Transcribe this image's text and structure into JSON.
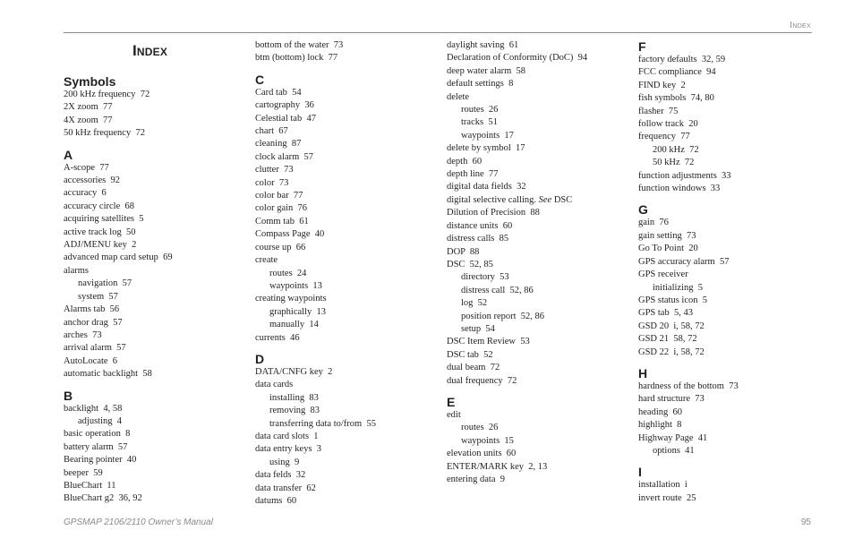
{
  "header": {
    "running_head": "Index",
    "title": "Index"
  },
  "footer": {
    "manual": "GPSMAP 2106/2110 Owner’s Manual",
    "page_number": "95"
  },
  "columns": [
    {
      "sections": [
        {
          "heading": "Symbols",
          "entries": [
            {
              "text": "200 kHz frequency  72",
              "sub": false
            },
            {
              "text": "2X zoom  77",
              "sub": false
            },
            {
              "text": "4X zoom  77",
              "sub": false
            },
            {
              "text": "50 kHz frequency  72",
              "sub": false
            }
          ]
        },
        {
          "heading": "A",
          "entries": [
            {
              "text": "A-scope  77",
              "sub": false
            },
            {
              "text": "accessories  92",
              "sub": false
            },
            {
              "text": "accuracy  6",
              "sub": false
            },
            {
              "text": "accuracy circle  68",
              "sub": false
            },
            {
              "text": "acquiring satellites  5",
              "sub": false
            },
            {
              "text": "active track log  50",
              "sub": false
            },
            {
              "text": "ADJ/MENU key  2",
              "sub": false
            },
            {
              "text": "advanced map card setup  69",
              "sub": false
            },
            {
              "text": "alarms",
              "sub": false
            },
            {
              "text": "navigation  57",
              "sub": true
            },
            {
              "text": "system  57",
              "sub": true
            },
            {
              "text": "Alarms tab  56",
              "sub": false
            },
            {
              "text": "anchor drag  57",
              "sub": false
            },
            {
              "text": "arches  73",
              "sub": false
            },
            {
              "text": "arrival alarm  57",
              "sub": false
            },
            {
              "text": "AutoLocate  6",
              "sub": false
            },
            {
              "text": "automatic backlight  58",
              "sub": false
            }
          ]
        },
        {
          "heading": "B",
          "entries": [
            {
              "text": "backlight  4, 58",
              "sub": false
            },
            {
              "text": "adjusting  4",
              "sub": true
            },
            {
              "text": "basic operation  8",
              "sub": false
            },
            {
              "text": "battery alarm  57",
              "sub": false
            },
            {
              "text": "Bearing pointer  40",
              "sub": false
            },
            {
              "text": "beeper  59",
              "sub": false
            },
            {
              "text": "BlueChart  11",
              "sub": false
            },
            {
              "text": "BlueChart g2  36, 92",
              "sub": false
            }
          ]
        }
      ]
    },
    {
      "sections": [
        {
          "heading": "",
          "entries": [
            {
              "text": "bottom of the water  73",
              "sub": false
            },
            {
              "text": "btm (bottom) lock  77",
              "sub": false
            }
          ]
        },
        {
          "heading": "C",
          "entries": [
            {
              "text": "Card tab  54",
              "sub": false
            },
            {
              "text": "cartography  36",
              "sub": false
            },
            {
              "text": "Celestial tab  47",
              "sub": false
            },
            {
              "text": "chart  67",
              "sub": false
            },
            {
              "text": "cleaning  87",
              "sub": false
            },
            {
              "text": "clock alarm  57",
              "sub": false
            },
            {
              "text": "clutter  73",
              "sub": false
            },
            {
              "text": "color  73",
              "sub": false
            },
            {
              "text": "color bar  77",
              "sub": false
            },
            {
              "text": "color gain  76",
              "sub": false
            },
            {
              "text": "Comm tab  61",
              "sub": false
            },
            {
              "text": "Compass Page  40",
              "sub": false
            },
            {
              "text": "course up  66",
              "sub": false
            },
            {
              "text": "create",
              "sub": false
            },
            {
              "text": "routes  24",
              "sub": true
            },
            {
              "text": "waypoints  13",
              "sub": true
            },
            {
              "text": "creating waypoints",
              "sub": false
            },
            {
              "text": "graphically  13",
              "sub": true
            },
            {
              "text": "manually  14",
              "sub": true
            },
            {
              "text": "currents  46",
              "sub": false
            }
          ]
        },
        {
          "heading": "D",
          "entries": [
            {
              "text": "DATA/CNFG key  2",
              "sub": false
            },
            {
              "text": "data cards",
              "sub": false
            },
            {
              "text": "installing  83",
              "sub": true
            },
            {
              "text": "removing  83",
              "sub": true
            },
            {
              "text": "transferring data to/from  55",
              "sub": true
            },
            {
              "text": "data card slots  1",
              "sub": false
            },
            {
              "text": "data entry keys  3",
              "sub": false
            },
            {
              "text": "using  9",
              "sub": true
            },
            {
              "text": "data felds  32",
              "sub": false
            },
            {
              "text": "data transfer  62",
              "sub": false
            },
            {
              "text": "datums  60",
              "sub": false
            }
          ]
        }
      ]
    },
    {
      "sections": [
        {
          "heading": "",
          "entries": [
            {
              "text": "daylight saving  61",
              "sub": false
            },
            {
              "text": "Declaration of Conformity (DoC)  94",
              "sub": false
            },
            {
              "text": "deep water alarm  58",
              "sub": false
            },
            {
              "text": "default settings  8",
              "sub": false
            },
            {
              "text": "delete",
              "sub": false
            },
            {
              "text": "routes  26",
              "sub": true
            },
            {
              "text": "tracks  51",
              "sub": true
            },
            {
              "text": "waypoints  17",
              "sub": true
            },
            {
              "text": "delete by symbol  17",
              "sub": false
            },
            {
              "text": "depth  60",
              "sub": false
            },
            {
              "text": "depth line  77",
              "sub": false
            },
            {
              "text": "digital data fields  32",
              "sub": false
            },
            {
              "text": "digital selective calling. ",
              "see": "See",
              "after": " DSC",
              "sub": false
            },
            {
              "text": "Dilution of Precision  88",
              "sub": false
            },
            {
              "text": "distance units  60",
              "sub": false
            },
            {
              "text": "distress calls  85",
              "sub": false
            },
            {
              "text": "DOP  88",
              "sub": false
            },
            {
              "text": "DSC  52, 85",
              "sub": false
            },
            {
              "text": "directory  53",
              "sub": true
            },
            {
              "text": "distress call  52, 86",
              "sub": true
            },
            {
              "text": "log  52",
              "sub": true
            },
            {
              "text": "position report  52, 86",
              "sub": true
            },
            {
              "text": "setup  54",
              "sub": true
            },
            {
              "text": "DSC Item Review  53",
              "sub": false
            },
            {
              "text": "DSC tab  52",
              "sub": false
            },
            {
              "text": "dual beam  72",
              "sub": false
            },
            {
              "text": "dual frequency  72",
              "sub": false
            }
          ]
        },
        {
          "heading": "E",
          "entries": [
            {
              "text": "edit",
              "sub": false
            },
            {
              "text": "routes  26",
              "sub": true
            },
            {
              "text": "waypoints  15",
              "sub": true
            },
            {
              "text": "elevation units  60",
              "sub": false
            },
            {
              "text": "ENTER/MARK key  2, 13",
              "sub": false
            },
            {
              "text": "entering data  9",
              "sub": false
            }
          ]
        }
      ]
    },
    {
      "sections": [
        {
          "heading": "F",
          "entries": [
            {
              "text": "factory defaults  32, 59",
              "sub": false
            },
            {
              "text": "FCC compliance  94",
              "sub": false
            },
            {
              "text": "FIND key  2",
              "sub": false
            },
            {
              "text": "fish symbols  74, 80",
              "sub": false
            },
            {
              "text": "flasher  75",
              "sub": false
            },
            {
              "text": "follow track  20",
              "sub": false
            },
            {
              "text": "frequency  77",
              "sub": false
            },
            {
              "text": "200 kHz  72",
              "sub": true
            },
            {
              "text": "50 kHz  72",
              "sub": true
            },
            {
              "text": "function adjustments  33",
              "sub": false
            },
            {
              "text": "function windows  33",
              "sub": false
            }
          ]
        },
        {
          "heading": "G",
          "entries": [
            {
              "text": "gain  76",
              "sub": false
            },
            {
              "text": "gain setting  73",
              "sub": false
            },
            {
              "text": "Go To Point  20",
              "sub": false
            },
            {
              "text": "GPS accuracy alarm  57",
              "sub": false
            },
            {
              "text": "GPS receiver",
              "sub": false
            },
            {
              "text": "initializing  5",
              "sub": true
            },
            {
              "text": "GPS status icon  5",
              "sub": false
            },
            {
              "text": "GPS tab  5, 43",
              "sub": false
            },
            {
              "text": "GSD 20  i, 58, 72",
              "sub": false
            },
            {
              "text": "GSD 21  58, 72",
              "sub": false
            },
            {
              "text": "GSD 22  i, 58, 72",
              "sub": false
            }
          ]
        },
        {
          "heading": "H",
          "entries": [
            {
              "text": "hardness of the bottom  73",
              "sub": false
            },
            {
              "text": "hard structure  73",
              "sub": false
            },
            {
              "text": "heading  60",
              "sub": false
            },
            {
              "text": "highlight  8",
              "sub": false
            },
            {
              "text": "Highway Page  41",
              "sub": false
            },
            {
              "text": "options  41",
              "sub": true
            }
          ]
        },
        {
          "heading": "I",
          "entries": [
            {
              "text": "installation  i",
              "sub": false
            },
            {
              "text": "invert route  25",
              "sub": false
            }
          ]
        }
      ]
    }
  ]
}
